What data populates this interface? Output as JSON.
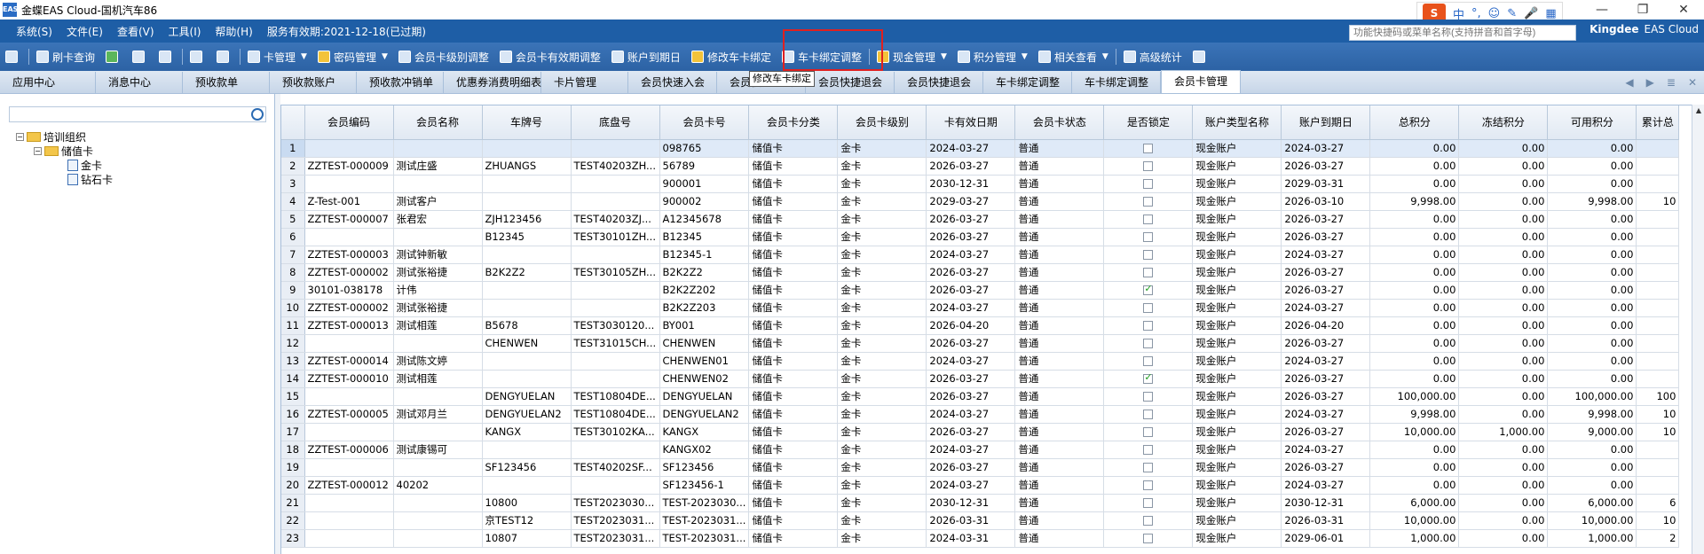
{
  "window": {
    "title": "金蝶EAS Cloud-国机汽车86",
    "app_icon": "EAS",
    "controls": [
      "—",
      "❐",
      "✕"
    ]
  },
  "ime": {
    "items": [
      "中",
      "°,",
      "☺",
      "✎",
      "🎤",
      "▦"
    ]
  },
  "menu": {
    "items": [
      "系统(S)",
      "文件(E)",
      "查看(V)",
      "工具(I)",
      "帮助(H)"
    ],
    "service": "服务有效期:2021-12-18(已过期)",
    "quick_placeholder": "功能快捷码或菜单名称(支持拼音和首字母)",
    "brand": "Kingdee",
    "brand_sub": "EAS Cloud"
  },
  "toolbar": {
    "items": [
      {
        "label": "刷卡查询"
      },
      {
        "label": "卡管理"
      },
      {
        "label": "密码管理"
      },
      {
        "label": "会员卡级别调整"
      },
      {
        "label": "会员卡有效期调整"
      },
      {
        "label": "账户到期日"
      },
      {
        "label": "修改车卡绑定"
      },
      {
        "label": "车卡绑定调整"
      },
      {
        "label": "现金管理"
      },
      {
        "label": "积分管理"
      },
      {
        "label": "相关查看"
      },
      {
        "label": "高级统计"
      }
    ],
    "tooltip": "修改车卡绑定"
  },
  "tabs": [
    "应用中心",
    "消息中心",
    "预收款单",
    "预收款账户",
    "预收款冲销单",
    "优惠券消费明细表",
    "卡片管理",
    "会员快速入会",
    "会员快速退会",
    "会员快捷退会",
    "会员快捷退会",
    "车卡绑定调整",
    "车卡绑定调整",
    "会员卡管理"
  ],
  "tree": {
    "root": "培训组织",
    "child": "储值卡",
    "leaves": [
      "金卡",
      "钻石卡"
    ]
  },
  "grid": {
    "columns": [
      "会员编码",
      "会员名称",
      "车牌号",
      "底盘号",
      "会员卡号",
      "会员卡分类",
      "会员卡级别",
      "卡有效日期",
      "会员卡状态",
      "是否锁定",
      "账户类型名称",
      "账户到期日",
      "总积分",
      "冻结积分",
      "可用积分",
      "累计总"
    ],
    "rows": [
      {
        "n": "1",
        "code": "",
        "name": "",
        "plate": "",
        "chassis": "",
        "card": "098765",
        "cat": "储值卡",
        "lvl": "金卡",
        "valid": "2024-03-27",
        "status": "普通",
        "lock": false,
        "acct": "现金账户",
        "exp": "2024-03-27",
        "total": "0.00",
        "frozen": "0.00",
        "avail": "0.00",
        "acc": ""
      },
      {
        "n": "2",
        "code": "ZZTEST-000009",
        "name": "测试庄盛",
        "plate": "ZHUANGS",
        "chassis": "TEST40203ZH...",
        "card": "56789",
        "cat": "储值卡",
        "lvl": "金卡",
        "valid": "2026-03-27",
        "status": "普通",
        "lock": false,
        "acct": "现金账户",
        "exp": "2026-03-27",
        "total": "0.00",
        "frozen": "0.00",
        "avail": "0.00",
        "acc": ""
      },
      {
        "n": "3",
        "code": "",
        "name": "",
        "plate": "",
        "chassis": "",
        "card": "900001",
        "cat": "储值卡",
        "lvl": "金卡",
        "valid": "2030-12-31",
        "status": "普通",
        "lock": false,
        "acct": "现金账户",
        "exp": "2029-03-31",
        "total": "0.00",
        "frozen": "0.00",
        "avail": "0.00",
        "acc": ""
      },
      {
        "n": "4",
        "code": "Z-Test-001",
        "name": "测试客户",
        "plate": "",
        "chassis": "",
        "card": "900002",
        "cat": "储值卡",
        "lvl": "金卡",
        "valid": "2029-03-27",
        "status": "普通",
        "lock": false,
        "acct": "现金账户",
        "exp": "2026-03-10",
        "total": "9,998.00",
        "frozen": "0.00",
        "avail": "9,998.00",
        "acc": "10"
      },
      {
        "n": "5",
        "code": "ZZTEST-000007",
        "name": "张君宏",
        "plate": "ZJH123456",
        "chassis": "TEST40203ZJ...",
        "card": "A12345678",
        "cat": "储值卡",
        "lvl": "金卡",
        "valid": "2026-03-27",
        "status": "普通",
        "lock": false,
        "acct": "现金账户",
        "exp": "2026-03-27",
        "total": "0.00",
        "frozen": "0.00",
        "avail": "0.00",
        "acc": ""
      },
      {
        "n": "6",
        "code": "",
        "name": "",
        "plate": "B12345",
        "chassis": "TEST30101ZH...",
        "card": "B12345",
        "cat": "储值卡",
        "lvl": "金卡",
        "valid": "2026-03-27",
        "status": "普通",
        "lock": false,
        "acct": "现金账户",
        "exp": "2026-03-27",
        "total": "0.00",
        "frozen": "0.00",
        "avail": "0.00",
        "acc": ""
      },
      {
        "n": "7",
        "code": "ZZTEST-000003",
        "name": "测试钟新敏",
        "plate": "",
        "chassis": "",
        "card": "B12345-1",
        "cat": "储值卡",
        "lvl": "金卡",
        "valid": "2024-03-27",
        "status": "普通",
        "lock": false,
        "acct": "现金账户",
        "exp": "2024-03-27",
        "total": "0.00",
        "frozen": "0.00",
        "avail": "0.00",
        "acc": ""
      },
      {
        "n": "8",
        "code": "ZZTEST-000002",
        "name": "测试张裕捷",
        "plate": "B2K2Z2",
        "chassis": "TEST30105ZH...",
        "card": "B2K2Z2",
        "cat": "储值卡",
        "lvl": "金卡",
        "valid": "2026-03-27",
        "status": "普通",
        "lock": false,
        "acct": "现金账户",
        "exp": "2026-03-27",
        "total": "0.00",
        "frozen": "0.00",
        "avail": "0.00",
        "acc": ""
      },
      {
        "n": "9",
        "code": "30101-038178",
        "name": "计伟",
        "plate": "",
        "chassis": "",
        "card": "B2K2Z202",
        "cat": "储值卡",
        "lvl": "金卡",
        "valid": "2026-03-27",
        "status": "普通",
        "lock": true,
        "acct": "现金账户",
        "exp": "2026-03-27",
        "total": "0.00",
        "frozen": "0.00",
        "avail": "0.00",
        "acc": ""
      },
      {
        "n": "10",
        "code": "ZZTEST-000002",
        "name": "测试张裕捷",
        "plate": "",
        "chassis": "",
        "card": "B2K2Z203",
        "cat": "储值卡",
        "lvl": "金卡",
        "valid": "2024-03-27",
        "status": "普通",
        "lock": false,
        "acct": "现金账户",
        "exp": "2024-03-27",
        "total": "0.00",
        "frozen": "0.00",
        "avail": "0.00",
        "acc": ""
      },
      {
        "n": "11",
        "code": "ZZTEST-000013",
        "name": "测试相莲",
        "plate": "B5678",
        "chassis": "TEST3030120...",
        "card": "BY001",
        "cat": "储值卡",
        "lvl": "金卡",
        "valid": "2026-04-20",
        "status": "普通",
        "lock": false,
        "acct": "现金账户",
        "exp": "2026-04-20",
        "total": "0.00",
        "frozen": "0.00",
        "avail": "0.00",
        "acc": ""
      },
      {
        "n": "12",
        "code": "",
        "name": "",
        "plate": "CHENWEN",
        "chassis": "TEST31015CH...",
        "card": "CHENWEN",
        "cat": "储值卡",
        "lvl": "金卡",
        "valid": "2026-03-27",
        "status": "普通",
        "lock": false,
        "acct": "现金账户",
        "exp": "2026-03-27",
        "total": "0.00",
        "frozen": "0.00",
        "avail": "0.00",
        "acc": ""
      },
      {
        "n": "13",
        "code": "ZZTEST-000014",
        "name": "测试陈文婷",
        "plate": "",
        "chassis": "",
        "card": "CHENWEN01",
        "cat": "储值卡",
        "lvl": "金卡",
        "valid": "2024-03-27",
        "status": "普通",
        "lock": false,
        "acct": "现金账户",
        "exp": "2024-03-27",
        "total": "0.00",
        "frozen": "0.00",
        "avail": "0.00",
        "acc": ""
      },
      {
        "n": "14",
        "code": "ZZTEST-000010",
        "name": "测试相莲",
        "plate": "",
        "chassis": "",
        "card": "CHENWEN02",
        "cat": "储值卡",
        "lvl": "金卡",
        "valid": "2026-03-27",
        "status": "普通",
        "lock": true,
        "acct": "现金账户",
        "exp": "2026-03-27",
        "total": "0.00",
        "frozen": "0.00",
        "avail": "0.00",
        "acc": ""
      },
      {
        "n": "15",
        "code": "",
        "name": "",
        "plate": "DENGYUELAN",
        "chassis": "TEST10804DE...",
        "card": "DENGYUELAN",
        "cat": "储值卡",
        "lvl": "金卡",
        "valid": "2026-03-27",
        "status": "普通",
        "lock": false,
        "acct": "现金账户",
        "exp": "2026-03-27",
        "total": "100,000.00",
        "frozen": "0.00",
        "avail": "100,000.00",
        "acc": "100"
      },
      {
        "n": "16",
        "code": "ZZTEST-000005",
        "name": "测试邓月兰",
        "plate": "DENGYUELAN2",
        "chassis": "TEST10804DE...",
        "card": "DENGYUELAN2",
        "cat": "储值卡",
        "lvl": "金卡",
        "valid": "2024-03-27",
        "status": "普通",
        "lock": false,
        "acct": "现金账户",
        "exp": "2024-03-27",
        "total": "9,998.00",
        "frozen": "0.00",
        "avail": "9,998.00",
        "acc": "10"
      },
      {
        "n": "17",
        "code": "",
        "name": "",
        "plate": "KANGX",
        "chassis": "TEST30102KA...",
        "card": "KANGX",
        "cat": "储值卡",
        "lvl": "金卡",
        "valid": "2026-03-27",
        "status": "普通",
        "lock": false,
        "acct": "现金账户",
        "exp": "2026-03-27",
        "total": "10,000.00",
        "frozen": "1,000.00",
        "avail": "9,000.00",
        "acc": "10"
      },
      {
        "n": "18",
        "code": "ZZTEST-000006",
        "name": "测试康锡可",
        "plate": "",
        "chassis": "",
        "card": "KANGX02",
        "cat": "储值卡",
        "lvl": "金卡",
        "valid": "2024-03-27",
        "status": "普通",
        "lock": false,
        "acct": "现金账户",
        "exp": "2024-03-27",
        "total": "0.00",
        "frozen": "0.00",
        "avail": "0.00",
        "acc": ""
      },
      {
        "n": "19",
        "code": "",
        "name": "",
        "plate": "SF123456",
        "chassis": "TEST40202SF...",
        "card": "SF123456",
        "cat": "储值卡",
        "lvl": "金卡",
        "valid": "2026-03-27",
        "status": "普通",
        "lock": false,
        "acct": "现金账户",
        "exp": "2026-03-27",
        "total": "0.00",
        "frozen": "0.00",
        "avail": "0.00",
        "acc": ""
      },
      {
        "n": "20",
        "code": "ZZTEST-000012",
        "name": "40202",
        "plate": "",
        "chassis": "",
        "card": "SF123456-1",
        "cat": "储值卡",
        "lvl": "金卡",
        "valid": "2024-03-27",
        "status": "普通",
        "lock": false,
        "acct": "现金账户",
        "exp": "2024-03-27",
        "total": "0.00",
        "frozen": "0.00",
        "avail": "0.00",
        "acc": ""
      },
      {
        "n": "21",
        "code": "",
        "name": "",
        "plate": "10800",
        "chassis": "TEST2023030...",
        "card": "TEST-2023030...",
        "cat": "储值卡",
        "lvl": "金卡",
        "valid": "2030-12-31",
        "status": "普通",
        "lock": false,
        "acct": "现金账户",
        "exp": "2030-12-31",
        "total": "6,000.00",
        "frozen": "0.00",
        "avail": "6,000.00",
        "acc": "6"
      },
      {
        "n": "22",
        "code": "",
        "name": "",
        "plate": "京TEST12",
        "chassis": "TEST2023031...",
        "card": "TEST-2023031...",
        "cat": "储值卡",
        "lvl": "金卡",
        "valid": "2026-03-31",
        "status": "普通",
        "lock": false,
        "acct": "现金账户",
        "exp": "2026-03-31",
        "total": "10,000.00",
        "frozen": "0.00",
        "avail": "10,000.00",
        "acc": "10"
      },
      {
        "n": "23",
        "code": "",
        "name": "",
        "plate": "10807",
        "chassis": "TEST2023031...",
        "card": "TEST-2023031...",
        "cat": "储值卡",
        "lvl": "金卡",
        "valid": "2024-03-31",
        "status": "普通",
        "lock": false,
        "acct": "现金账户",
        "exp": "2029-06-01",
        "total": "1,000.00",
        "frozen": "0.00",
        "avail": "1,000.00",
        "acc": "2"
      }
    ]
  }
}
